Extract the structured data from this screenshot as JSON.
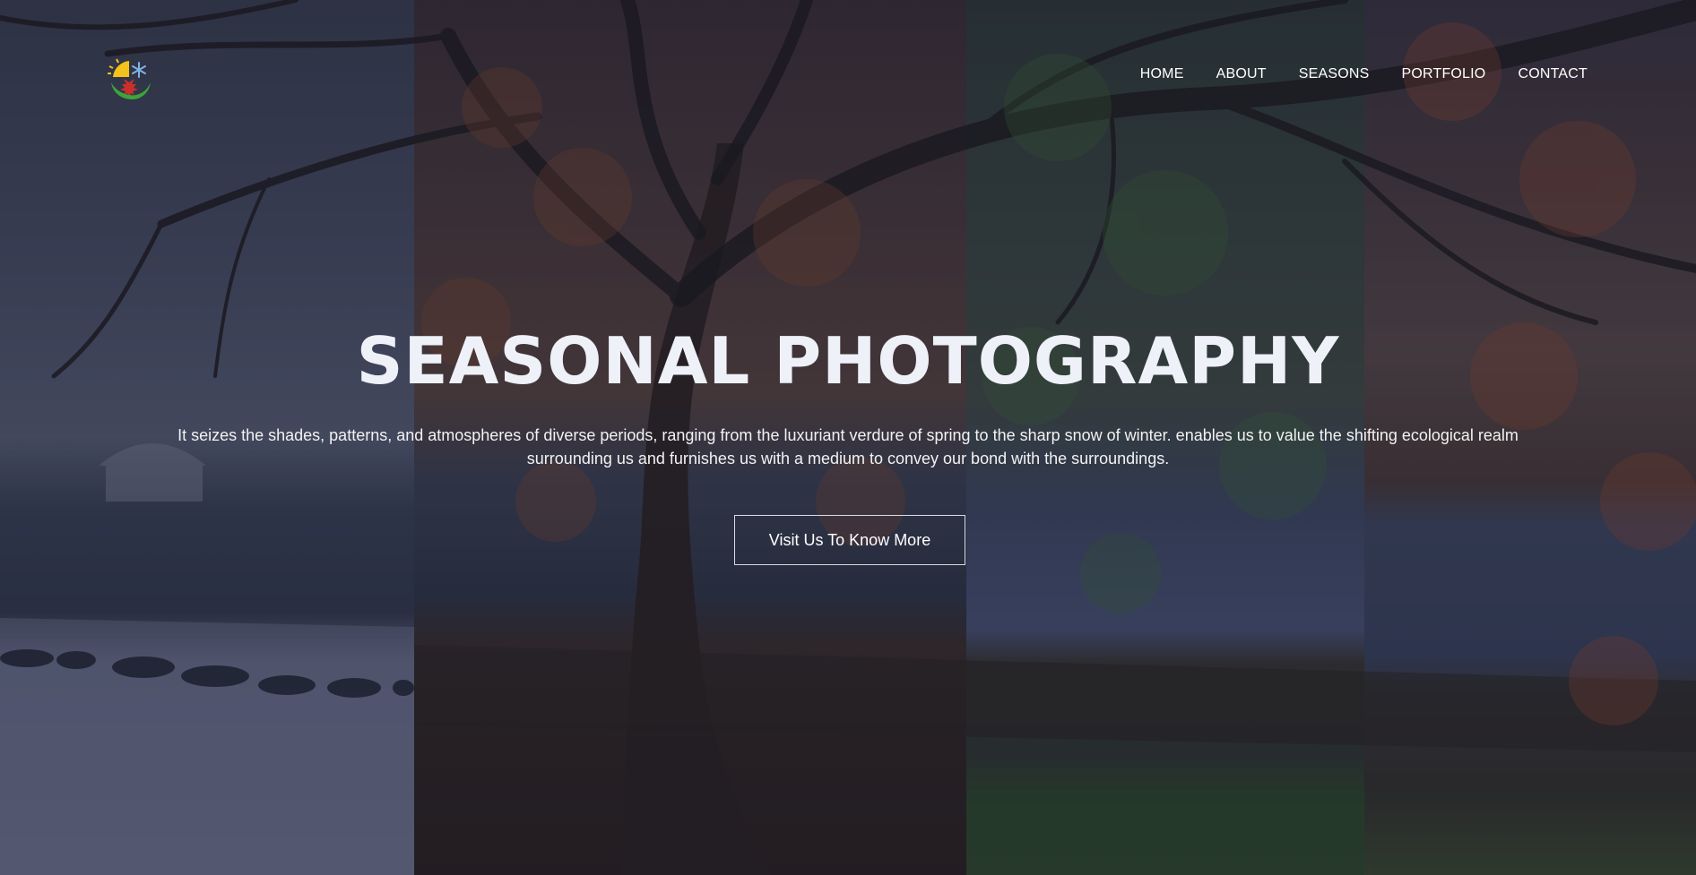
{
  "logo": {
    "icons": [
      "sun-icon",
      "snowflake-icon",
      "maple-leaf-icon",
      "leaf-swoosh-icon"
    ]
  },
  "nav": {
    "items": [
      {
        "label": "HOME"
      },
      {
        "label": "ABOUT"
      },
      {
        "label": "SEASONS"
      },
      {
        "label": "PORTFOLIO"
      },
      {
        "label": "CONTACT"
      }
    ]
  },
  "hero": {
    "title": "SEASONAL PHOTOGRAPHY",
    "description": "It seizes the shades, patterns, and atmospheres of diverse periods, ranging from the luxuriant verdure of spring to the sharp snow of winter. enables us to value the shifting ecological realm surrounding us and furnishes us with a medium to convey our bond with the surroundings.",
    "cta_label": "Visit Us To Know More"
  },
  "background": {
    "panels": [
      "winter",
      "autumn",
      "summer",
      "fall"
    ]
  },
  "colors": {
    "overlay": "#161a2a",
    "text": "#ffffff",
    "title": "#eef1f8",
    "button_border": "#d8dbe3"
  }
}
